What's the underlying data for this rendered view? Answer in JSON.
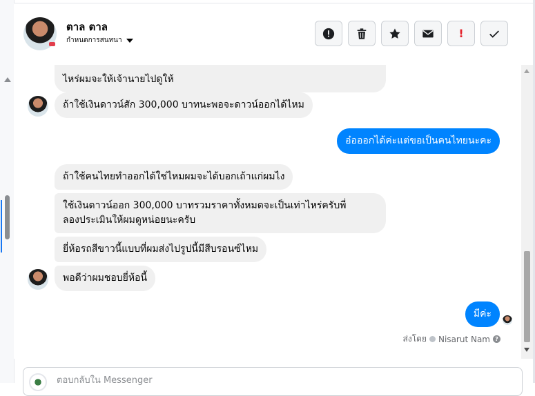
{
  "header": {
    "contact_name": "ตาล ตาล",
    "convo_settings_label": "กำหนดการสนทนา"
  },
  "actions": [
    {
      "name": "report-spam-button",
      "icon": "exclamation-circle-icon"
    },
    {
      "name": "delete-button",
      "icon": "trash-icon"
    },
    {
      "name": "star-button",
      "icon": "star-icon"
    },
    {
      "name": "mark-unread-button",
      "icon": "envelope-icon"
    },
    {
      "name": "follow-up-button",
      "icon": "exclamation-icon",
      "label": "!"
    },
    {
      "name": "mark-done-button",
      "icon": "check-icon"
    }
  ],
  "messages": {
    "m1_line1": "ไหร่ผมจะให้เจ้านายไปดูให้",
    "m2": "ถ้าใช้เงินดาวน์สัก 300,000 บาทนะพอจะดาวน์ออกได้ไหม",
    "m3": "อ๋อออกได้ค่ะแต่ขอเป็นคนไทยนะคะ",
    "m4": "ถ้าใช้คนไทยทำออกได้ใช่ไหมผมจะได้บอกเถ้าแก่ผมไง",
    "m5_line1": "ใช้เงินดาวน์ออก 300,000 บาทรวมราคาทั้งหมดจะเป็นเท่าไหร่ครับพี่",
    "m5_line2": "ลองประเมินให้ผมดูหน่อยนะครับ",
    "m6": "ยี่ห้อรถสีขาวนี้แบบที่ผมส่งไปรูปนี้มีสีบรอนซ์ไหม",
    "m7": "พอดีว่าผมชอบยี่ห้อนี้",
    "m8": "มีค่ะ"
  },
  "sent_by": {
    "prefix": "ส่งโดย",
    "name": "Nisarut Nam"
  },
  "composer": {
    "placeholder": "ตอบกลับใน Messenger"
  },
  "colors": {
    "outgoing_bubble": "#0084ff",
    "incoming_bubble": "#f0f0f0",
    "accent": "#1877f2",
    "follow_up": "#e4212b"
  }
}
